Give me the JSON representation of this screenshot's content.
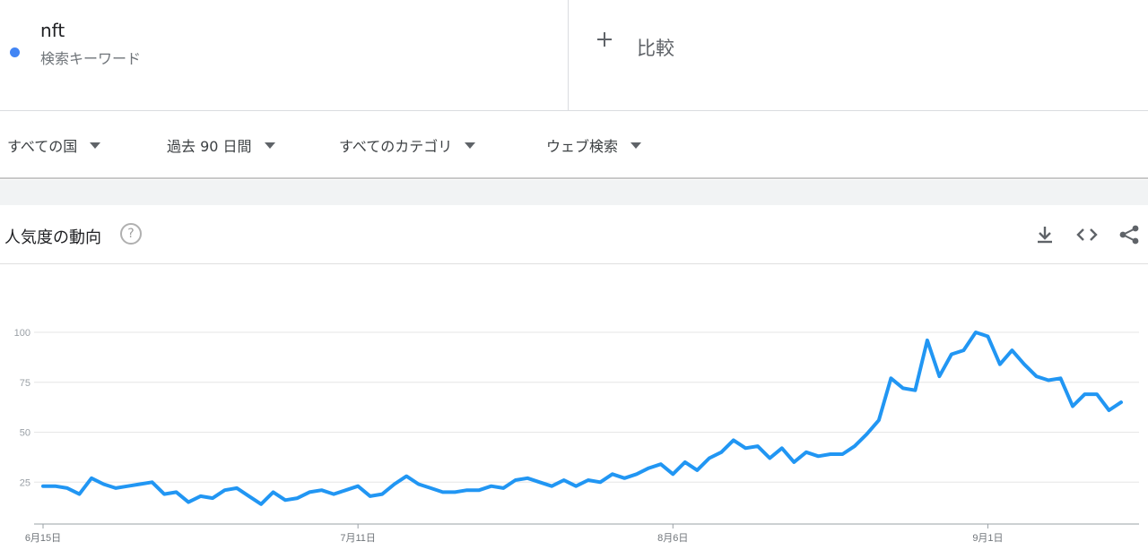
{
  "term": {
    "name": "nft",
    "subtitle": "検索キーワード",
    "color": "#4285f4"
  },
  "compare": {
    "icon": "plus-icon",
    "label": "比較"
  },
  "filters": [
    {
      "label": "すべての国"
    },
    {
      "label": "過去 90 日間"
    },
    {
      "label": "すべてのカテゴリ"
    },
    {
      "label": "ウェブ検索"
    }
  ],
  "panel": {
    "title": "人気度の動向",
    "help": "?",
    "icons": [
      "download-icon",
      "embed-icon",
      "share-icon"
    ]
  },
  "chart_data": {
    "type": "line",
    "title": "",
    "ylim": [
      0,
      100
    ],
    "yticks": [
      25,
      50,
      75,
      100
    ],
    "grid": true,
    "xtick_labels": [
      {
        "label": "6月15日",
        "index": 0
      },
      {
        "label": "7月11日",
        "index": 26
      },
      {
        "label": "8月6日",
        "index": 52
      },
      {
        "label": "9月1日",
        "index": 78
      }
    ],
    "series": [
      {
        "color": "#2196f3",
        "values": [
          23,
          23,
          22,
          19,
          27,
          24,
          22,
          23,
          24,
          25,
          19,
          20,
          15,
          18,
          17,
          21,
          22,
          18,
          14,
          20,
          16,
          17,
          20,
          21,
          19,
          21,
          23,
          18,
          19,
          24,
          28,
          24,
          22,
          20,
          20,
          21,
          21,
          23,
          22,
          26,
          27,
          25,
          23,
          26,
          23,
          26,
          25,
          29,
          27,
          29,
          32,
          34,
          29,
          35,
          31,
          37,
          40,
          46,
          42,
          43,
          37,
          42,
          35,
          40,
          38,
          39,
          39,
          43,
          49,
          56,
          77,
          72,
          71,
          96,
          78,
          89,
          91,
          100,
          98,
          84,
          91,
          84,
          78,
          76,
          77,
          63,
          69,
          69,
          61,
          65
        ]
      }
    ]
  }
}
